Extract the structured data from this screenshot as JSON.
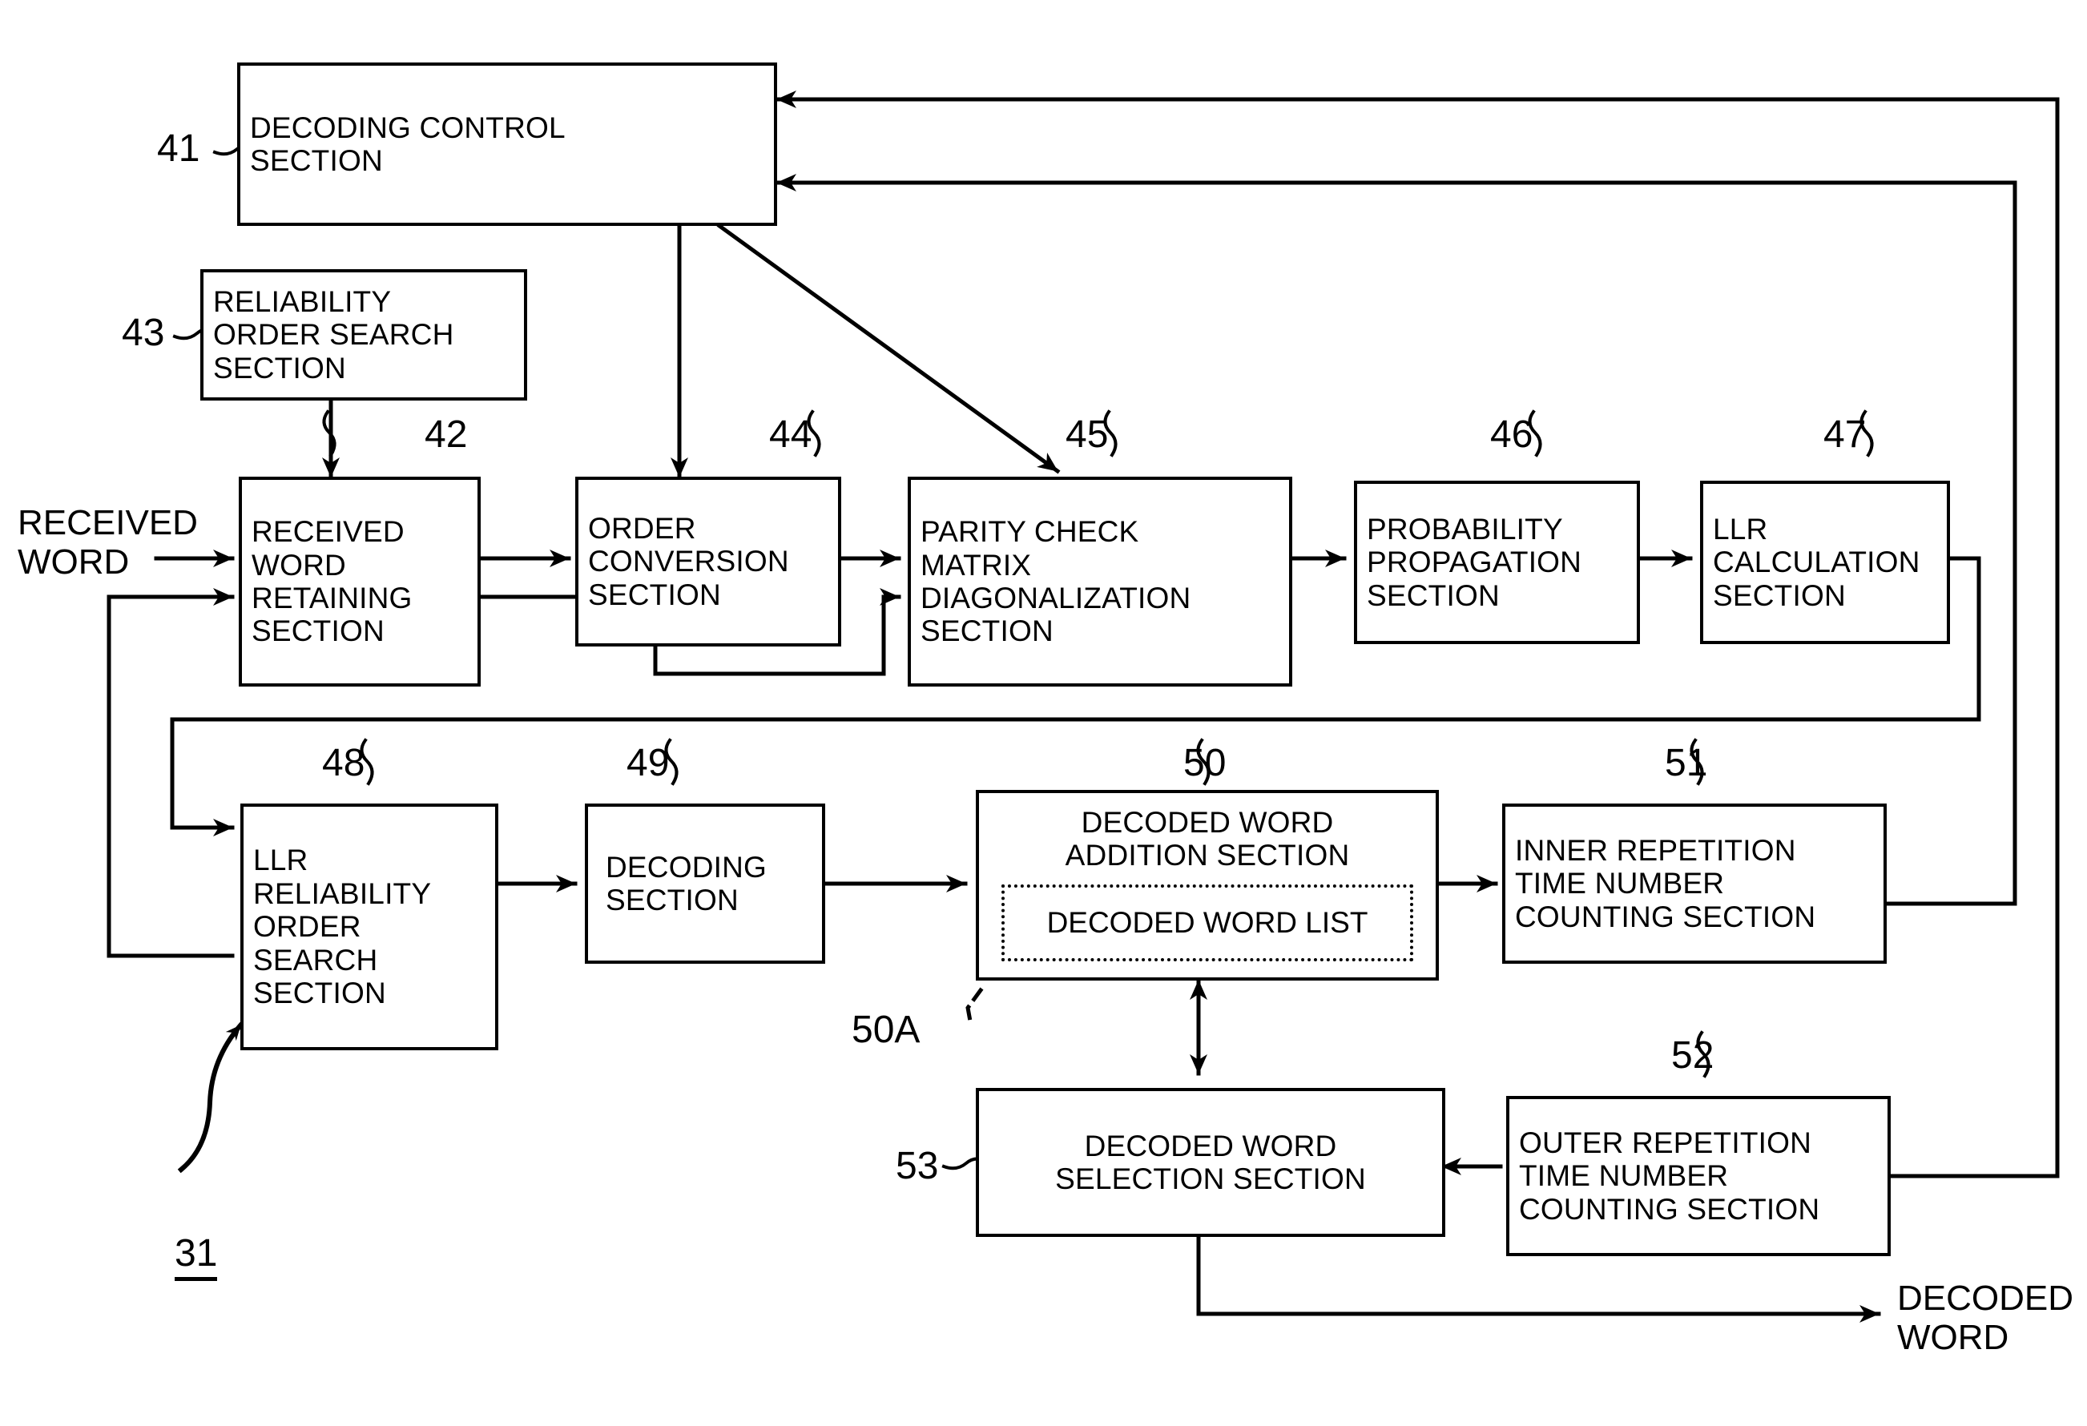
{
  "figure": {
    "figure_number": "31",
    "input_label": "RECEIVED\nWORD",
    "output_label": "DECODED\nWORD"
  },
  "blocks": [
    {
      "ref": "41",
      "label": "DECODING CONTROL\nSECTION",
      "name": "decoding-control-section"
    },
    {
      "ref": "43",
      "label": "RELIABILITY\nORDER SEARCH\nSECTION",
      "name": "reliability-order-search-section"
    },
    {
      "ref": "42",
      "label": "RECEIVED\nWORD\nRETAINING\nSECTION",
      "name": "received-word-retaining-section"
    },
    {
      "ref": "44",
      "label": "ORDER\nCONVERSION\nSECTION",
      "name": "order-conversion-section"
    },
    {
      "ref": "45",
      "label": "PARITY CHECK\nMATRIX\nDIAGONALIZATION\nSECTION",
      "name": "parity-check-matrix-diagonalization-section"
    },
    {
      "ref": "46",
      "label": "PROBABILITY\nPROPAGATION\nSECTION",
      "name": "probability-propagation-section"
    },
    {
      "ref": "47",
      "label": "LLR\nCALCULATION\nSECTION",
      "name": "llr-calculation-section"
    },
    {
      "ref": "48",
      "label": "LLR\nRELIABILITY\nORDER\nSEARCH\nSECTION",
      "name": "llr-reliability-order-search-section"
    },
    {
      "ref": "49",
      "label": "DECODING\nSECTION",
      "name": "decoding-section"
    },
    {
      "ref": "50",
      "label": "DECODED WORD\nADDITION SECTION",
      "name": "decoded-word-addition-section"
    },
    {
      "ref": "50A",
      "label": "DECODED WORD LIST",
      "name": "decoded-word-list"
    },
    {
      "ref": "51",
      "label": "INNER REPETITION\nTIME NUMBER\nCOUNTING SECTION",
      "name": "inner-repetition-time-number-counting-section"
    },
    {
      "ref": "52",
      "label": "OUTER REPETITION\nTIME NUMBER\nCOUNTING SECTION",
      "name": "outer-repetition-time-number-counting-section"
    },
    {
      "ref": "53",
      "label": "DECODED WORD\nSELECTION SECTION",
      "name": "decoded-word-selection-section"
    }
  ],
  "colors": {
    "ink": "#000000",
    "paper": "#ffffff"
  }
}
